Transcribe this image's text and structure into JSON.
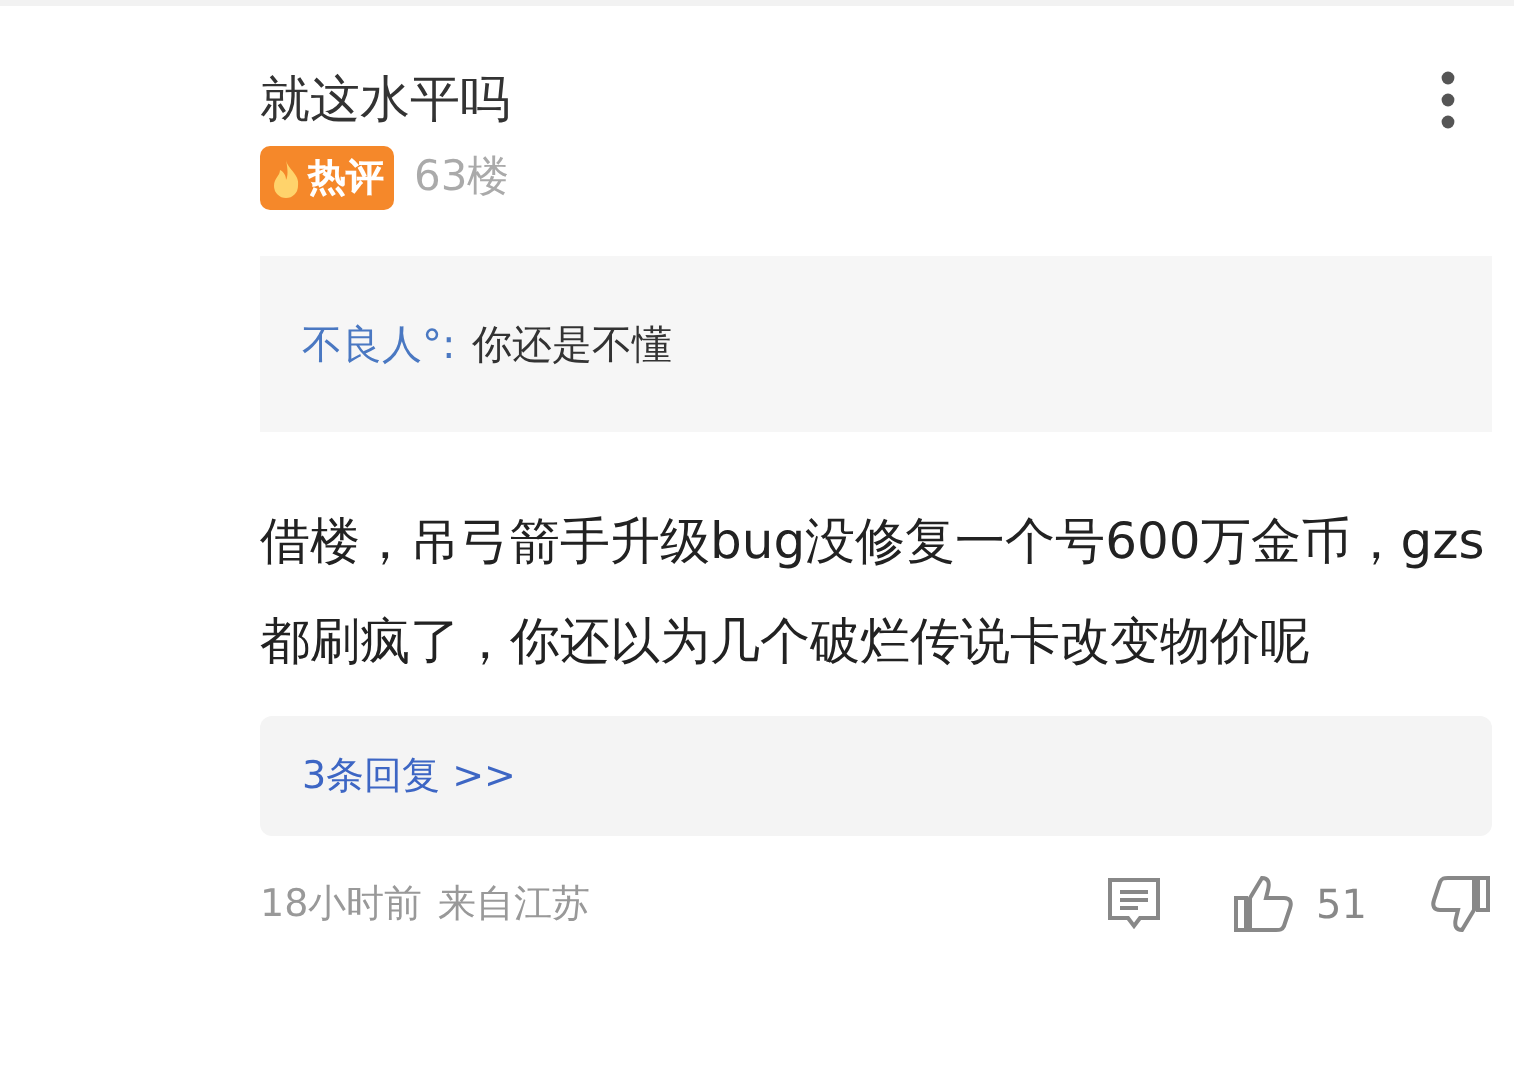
{
  "comment": {
    "username": "就这水平吗",
    "badge": "热评",
    "floor": "63楼",
    "quote": {
      "author": "不良人°:",
      "text": "你还是不懂"
    },
    "body": "借楼，吊弓箭手升级bug没修复一个号600万金币，gzs都刷疯了，你还以为几个破烂传说卡改变物价呢",
    "replies_link": "3条回复 >>",
    "time": "18小时前",
    "location": "来自江苏",
    "likes": "51"
  }
}
